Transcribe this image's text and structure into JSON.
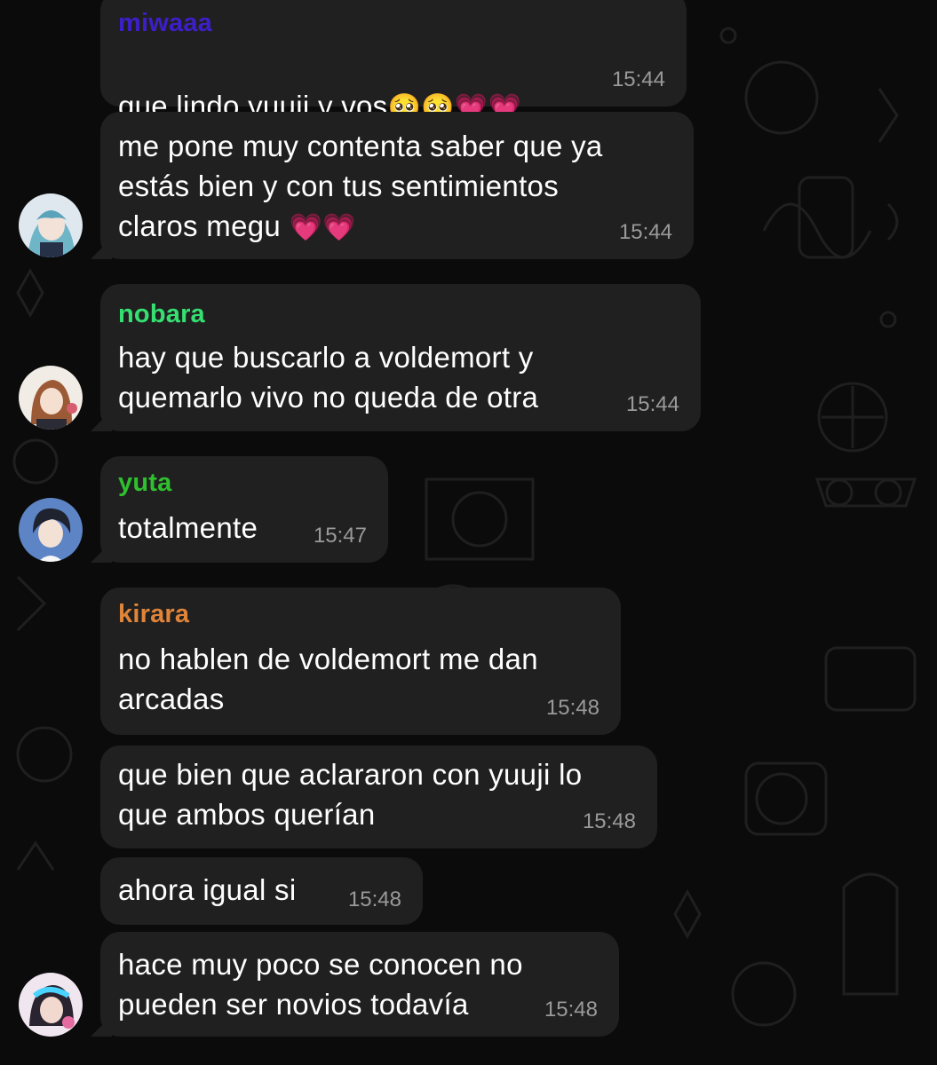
{
  "messages": [
    {
      "sender": "miwaaa",
      "text": "que lindo yuuji y vos",
      "emoji": "🥺🥺💗💗",
      "time": "15:44"
    },
    {
      "text": "me pone muy contenta saber que ya\nestás bien y con tus sentimientos\nclaros megu",
      "emoji": "💗💗",
      "time": "15:44"
    },
    {
      "sender": "nobara",
      "text": "hay que buscarlo a voldemort y\nquemarlo vivo no queda de otra",
      "time": "15:44"
    },
    {
      "sender": "yuta",
      "text": "totalmente",
      "time": "15:47"
    },
    {
      "sender": "kirara",
      "text": "no hablen de voldemort me dan\narcadas",
      "time": "15:48"
    },
    {
      "text": "que bien que aclararon con yuuji lo\nque ambos querían",
      "time": "15:48"
    },
    {
      "text": "ahora igual si",
      "time": "15:48"
    },
    {
      "text": "hace muy poco se conocen no\npueden ser novios todavía",
      "time": "15:48"
    }
  ],
  "colors": {
    "miwaaa": "#3d1fc9",
    "nobara": "#35e070",
    "yuta": "#2fbf2f",
    "kirara": "#e0843a",
    "bubble": "#202020",
    "background": "#0b0b0b"
  },
  "icons": [
    "avatar-miwaaa",
    "avatar-nobara",
    "avatar-yuta",
    "avatar-kirara"
  ]
}
